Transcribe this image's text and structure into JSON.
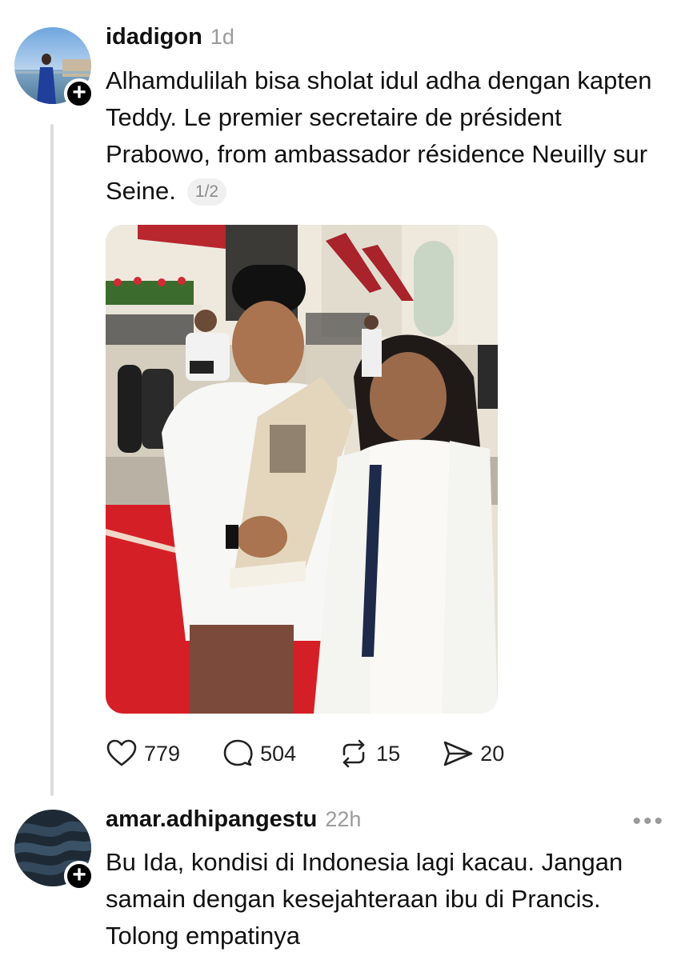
{
  "posts": [
    {
      "username": "idadigon",
      "time": "1d",
      "text": "Alhamdulilah bisa sholat idul adha dengan kapten Teddy. Le premier secretaire de président Prabowo, from ambassador résidence Neuilly sur Seine.",
      "pager": "1/2",
      "stats": {
        "likes": "779",
        "replies": "504",
        "reposts": "15",
        "shares": "20"
      }
    },
    {
      "username": "amar.adhipangestu",
      "time": "22h",
      "text": "Bu Ida, kondisi di Indonesia lagi kacau. Jangan samain dengan kesejahteraan ibu di Prancis. Tolong empatinya",
      "more": "•••"
    }
  ],
  "icons": {
    "like": "heart-icon",
    "reply": "speech-bubble-icon",
    "repost": "repost-arrows-icon",
    "share": "paper-plane-icon",
    "follow": "plus-icon",
    "more": "more-options-icon"
  }
}
